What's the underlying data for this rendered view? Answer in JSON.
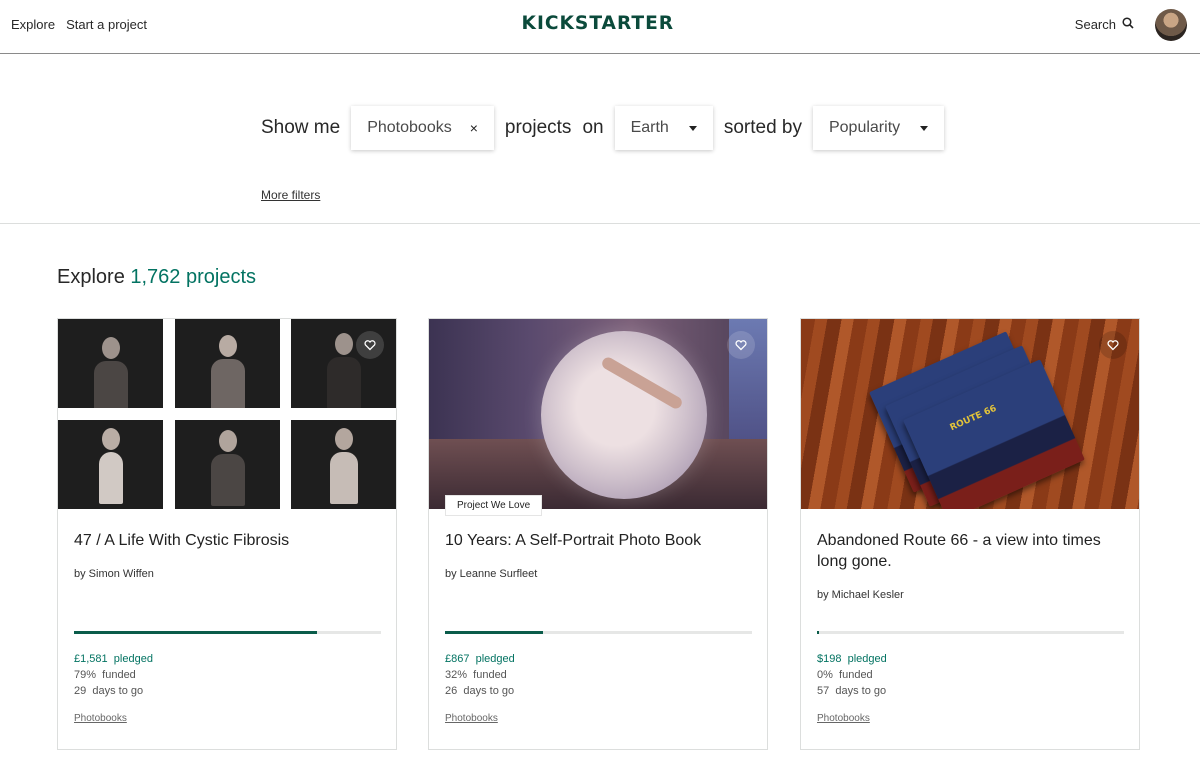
{
  "header": {
    "nav": [
      "Explore",
      "Start a project"
    ],
    "logo": "KICKSTARTER",
    "search_label": "Search"
  },
  "filters": {
    "show_me": "Show me",
    "category": "Photobooks",
    "clear_symbol": "×",
    "projects_word": "projects",
    "on_word": "on",
    "location": "Earth",
    "sorted_by": "sorted by",
    "sort": "Popularity",
    "more_filters": "More filters"
  },
  "explore": {
    "prefix": "Explore",
    "count": "1,762 projects"
  },
  "cards": [
    {
      "title": "47 / A Life With Cystic Fibrosis",
      "creator": "by Simon Wiffen",
      "funded_fraction": 0.79,
      "pledged_amount": "£1,581",
      "pledged_label": "pledged",
      "funded_percent": "79%",
      "funded_label": "funded",
      "days": "29",
      "days_label": "days to go",
      "category": "Photobooks",
      "badge": ""
    },
    {
      "title": "10 Years: A Self-Portrait Photo Book",
      "creator": "by Leanne Surfleet",
      "funded_fraction": 0.32,
      "pledged_amount": "£867",
      "pledged_label": "pledged",
      "funded_percent": "32%",
      "funded_label": "funded",
      "days": "26",
      "days_label": "days to go",
      "category": "Photobooks",
      "badge": "Project We Love"
    },
    {
      "title": "Abandoned Route 66 - a view into times long gone.",
      "creator": "by Michael Kesler",
      "funded_fraction": 0.0,
      "pledged_amount": "$198",
      "pledged_label": "pledged",
      "funded_percent": "0%",
      "funded_label": "funded",
      "days": "57",
      "days_label": "days to go",
      "category": "Photobooks",
      "badge": ""
    }
  ],
  "book_text": "ROUTE 66",
  "colors": {
    "brand": "#0b4a3b",
    "accent_green": "#037362",
    "progress": "#0a5c4a"
  }
}
